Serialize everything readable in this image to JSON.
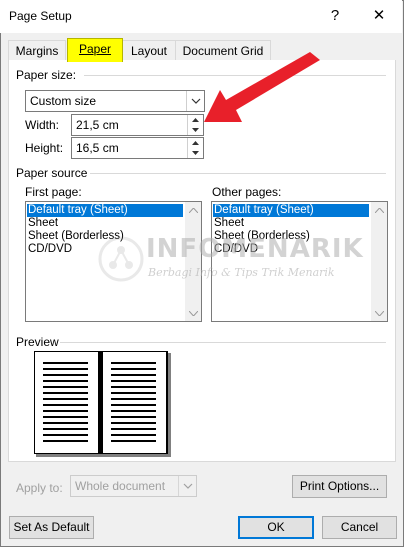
{
  "window": {
    "title": "Page Setup",
    "help_glyph": "?",
    "close_glyph": "✕"
  },
  "tabs": [
    {
      "label": "Margins",
      "active": false
    },
    {
      "label": "Paper",
      "active": true
    },
    {
      "label": "Layout",
      "active": false
    },
    {
      "label": "Document Grid",
      "active": false
    }
  ],
  "paper_size": {
    "section_label": "Paper size:",
    "selected": "Custom size",
    "width_label": "Width:",
    "width_value": "21,5 cm",
    "height_label": "Height:",
    "height_value": "16,5 cm"
  },
  "paper_source": {
    "section_label": "Paper source",
    "first_page_label": "First page:",
    "other_pages_label": "Other pages:",
    "first_page_items": [
      "Default tray (Sheet)",
      "Sheet",
      "Sheet (Borderless)",
      "CD/DVD"
    ],
    "other_pages_items": [
      "Default tray (Sheet)",
      "Sheet",
      "Sheet (Borderless)",
      "CD/DVD"
    ],
    "selected_index": 0
  },
  "preview": {
    "section_label": "Preview"
  },
  "apply_to": {
    "label": "Apply to:",
    "value": "Whole document"
  },
  "buttons": {
    "print_options": "Print Options...",
    "set_as_default": "Set As Default",
    "ok": "OK",
    "cancel": "Cancel"
  },
  "watermark": {
    "title": "INFOMENARIK",
    "subtitle": "Berbagi Info & Tips Trik Menarik"
  },
  "colors": {
    "selection": "#0078d7",
    "active_tab_highlight": "#ffff00",
    "arrow": "#e8202a"
  }
}
